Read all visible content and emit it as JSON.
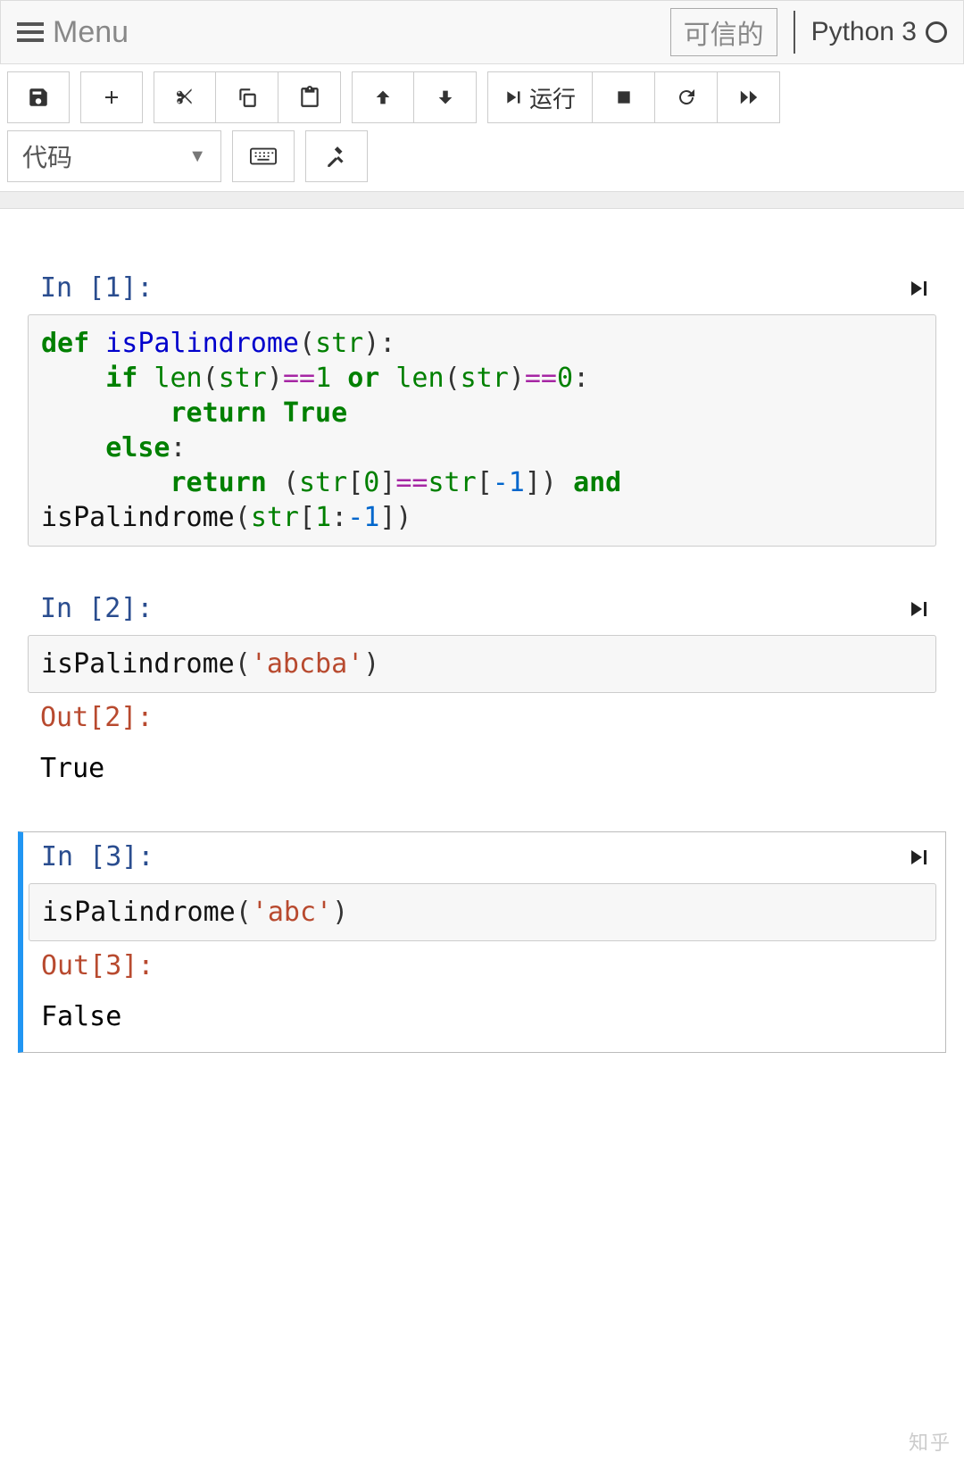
{
  "header": {
    "menu_label": "Menu",
    "trusted_label": "可信的",
    "kernel_label": "Python 3"
  },
  "toolbar": {
    "run_label": "运行",
    "cell_type": "代码"
  },
  "cells": [
    {
      "in_prompt": "In [1]:",
      "code_tokens": [
        {
          "t": "def ",
          "c": "kw-def"
        },
        {
          "t": "isPalindrome",
          "c": "fn"
        },
        {
          "t": "(",
          "c": "pn"
        },
        {
          "t": "str",
          "c": "bi"
        },
        {
          "t": "):",
          "c": "pn"
        },
        {
          "t": "\n    ",
          "c": "pn"
        },
        {
          "t": "if ",
          "c": "kw"
        },
        {
          "t": "len",
          "c": "bi"
        },
        {
          "t": "(",
          "c": "pn"
        },
        {
          "t": "str",
          "c": "bi"
        },
        {
          "t": ")",
          "c": "pn"
        },
        {
          "t": "==",
          "c": "op"
        },
        {
          "t": "1",
          "c": "num"
        },
        {
          "t": " ",
          "c": "pn"
        },
        {
          "t": "or ",
          "c": "kw"
        },
        {
          "t": "len",
          "c": "bi"
        },
        {
          "t": "(",
          "c": "pn"
        },
        {
          "t": "str",
          "c": "bi"
        },
        {
          "t": ")",
          "c": "pn"
        },
        {
          "t": "==",
          "c": "op"
        },
        {
          "t": "0",
          "c": "num"
        },
        {
          "t": ":",
          "c": "pn"
        },
        {
          "t": "\n        ",
          "c": "pn"
        },
        {
          "t": "return ",
          "c": "kw"
        },
        {
          "t": "True",
          "c": "kw"
        },
        {
          "t": "\n    ",
          "c": "pn"
        },
        {
          "t": "else",
          "c": "kw"
        },
        {
          "t": ":",
          "c": "pn"
        },
        {
          "t": "\n        ",
          "c": "pn"
        },
        {
          "t": "return ",
          "c": "kw"
        },
        {
          "t": "(",
          "c": "pn"
        },
        {
          "t": "str",
          "c": "bi"
        },
        {
          "t": "[",
          "c": "pn"
        },
        {
          "t": "0",
          "c": "num"
        },
        {
          "t": "]",
          "c": "pn"
        },
        {
          "t": "==",
          "c": "op"
        },
        {
          "t": "str",
          "c": "bi"
        },
        {
          "t": "[",
          "c": "pn"
        },
        {
          "t": "-1",
          "c": "negnum"
        },
        {
          "t": "])",
          "c": "pn"
        },
        {
          "t": " ",
          "c": "pn"
        },
        {
          "t": "and",
          "c": "kw"
        },
        {
          "t": " ",
          "c": "pn"
        },
        {
          "t": "isPalindrome",
          "c": "nm"
        },
        {
          "t": "(",
          "c": "pn"
        },
        {
          "t": "str",
          "c": "bi"
        },
        {
          "t": "[",
          "c": "pn"
        },
        {
          "t": "1",
          "c": "num"
        },
        {
          "t": ":",
          "c": "pn"
        },
        {
          "t": "-1",
          "c": "negnum"
        },
        {
          "t": "])",
          "c": "pn"
        }
      ]
    },
    {
      "in_prompt": "In [2]:",
      "code_tokens": [
        {
          "t": "isPalindrome",
          "c": "nm"
        },
        {
          "t": "(",
          "c": "pn"
        },
        {
          "t": "'abcba'",
          "c": "str"
        },
        {
          "t": ")",
          "c": "pn"
        }
      ],
      "out_prompt": "Out[2]:",
      "output": "True"
    },
    {
      "in_prompt": "In [3]:",
      "selected": true,
      "code_tokens": [
        {
          "t": "isPalindrome",
          "c": "nm"
        },
        {
          "t": "(",
          "c": "pn"
        },
        {
          "t": "'abc'",
          "c": "str"
        },
        {
          "t": ")",
          "c": "pn"
        }
      ],
      "out_prompt": "Out[3]:",
      "output": "False"
    }
  ],
  "watermark": "知乎"
}
